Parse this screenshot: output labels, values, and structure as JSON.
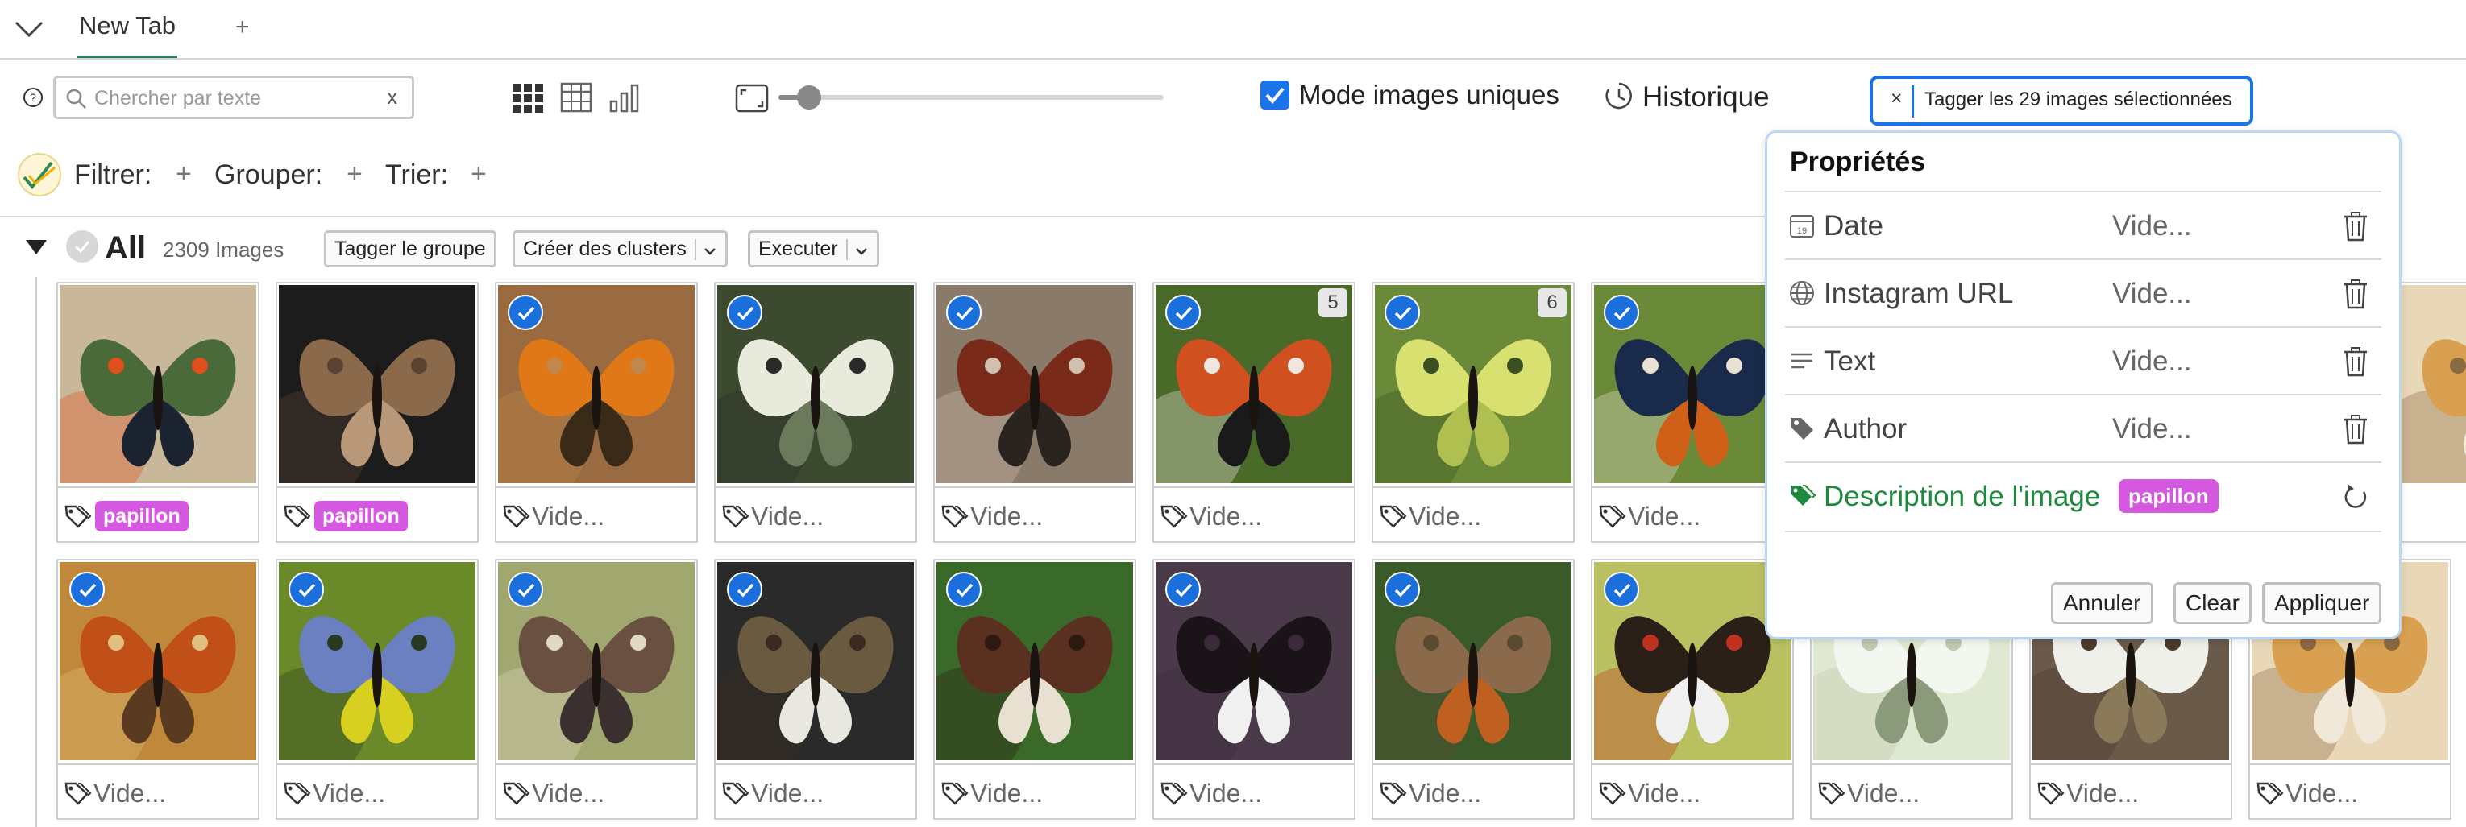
{
  "tabs": {
    "active_label": "New Tab",
    "add_label": "+"
  },
  "toolbar": {
    "search_placeholder": "Chercher par texte",
    "search_clear": "x",
    "mode_label": "Mode images uniques",
    "mode_checked": true,
    "history_label": "Historique",
    "tag_selected_close": "×",
    "tag_selected_label": "Tagger les 29 images sélectionnées",
    "zoom_level": 0.08
  },
  "filters": {
    "filter_label": "Filtrer:",
    "group_label": "Grouper:",
    "sort_label": "Trier:",
    "plus": "+"
  },
  "group": {
    "name": "All",
    "count": "2309 Images",
    "tag_group_button": "Tagger le groupe",
    "clusters_button": "Créer des clusters",
    "execute_button": "Executer"
  },
  "colors": {
    "accent": "#1a73e8",
    "tag_pill": "#d459e0",
    "desc_green": "#1e8a3e"
  },
  "cards_row1": [
    {
      "tag": "papillon",
      "selected": false,
      "count": ""
    },
    {
      "tag": "papillon",
      "selected": false,
      "count": ""
    },
    {
      "tag": "Vide...",
      "selected": true,
      "count": ""
    },
    {
      "tag": "Vide...",
      "selected": true,
      "count": ""
    },
    {
      "tag": "Vide...",
      "selected": true,
      "count": ""
    },
    {
      "tag": "Vide...",
      "selected": true,
      "count": "5"
    },
    {
      "tag": "Vide...",
      "selected": true,
      "count": "6"
    },
    {
      "tag": "Vide...",
      "selected": true,
      "count": ""
    }
  ],
  "cards_row2": [
    {
      "tag": "Vide...",
      "selected": true
    },
    {
      "tag": "Vide...",
      "selected": true
    },
    {
      "tag": "Vide...",
      "selected": true
    },
    {
      "tag": "Vide...",
      "selected": true
    },
    {
      "tag": "Vide...",
      "selected": true
    },
    {
      "tag": "Vide...",
      "selected": true
    },
    {
      "tag": "Vide...",
      "selected": true
    },
    {
      "tag": "Vide...",
      "selected": true
    },
    {
      "tag": "Vide...",
      "selected": false
    },
    {
      "tag": "Vide...",
      "selected": false
    },
    {
      "tag": "Vide...",
      "selected": false
    }
  ],
  "properties": {
    "title": "Propriétés",
    "rows": [
      {
        "icon": "calendar-icon",
        "name": "Date",
        "value": "Vide...",
        "action": "trash-icon"
      },
      {
        "icon": "globe-icon",
        "name": "Instagram URL",
        "value": "Vide...",
        "action": "trash-icon"
      },
      {
        "icon": "text-lines-icon",
        "name": "Text",
        "value": "Vide...",
        "action": "trash-icon"
      },
      {
        "icon": "tag-icon",
        "name": "Author",
        "value": "Vide...",
        "action": "trash-icon"
      },
      {
        "icon": "tags-icon",
        "name": "Description de l'image",
        "value": "papillon",
        "action": "undo-icon"
      }
    ],
    "cancel": "Annuler",
    "clear": "Clear",
    "apply": "Appliquer"
  }
}
